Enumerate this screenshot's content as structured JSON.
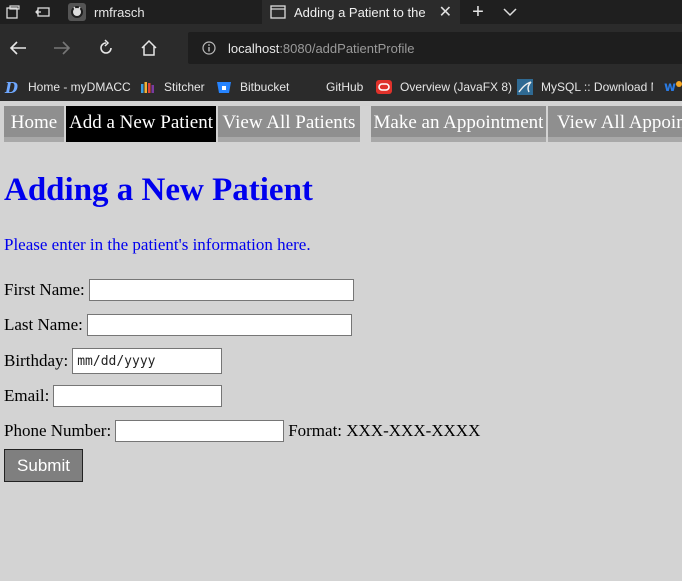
{
  "browser": {
    "tabs": [
      {
        "label": "rmfrasch",
        "icon": "github-icon"
      },
      {
        "label": "Adding a Patient to the",
        "icon": "page-icon"
      }
    ],
    "url_host": "localhost",
    "url_rest": ":8080/addPatientProfile",
    "favorites": [
      {
        "label": "Home - myDMACC",
        "icon": "dmacc-icon"
      },
      {
        "label": "Stitcher",
        "icon": "stitcher-icon"
      },
      {
        "label": "Bitbucket",
        "icon": "bitbucket-icon"
      },
      {
        "label": "GitHub",
        "icon": "none"
      },
      {
        "label": "Overview (JavaFX 8)",
        "icon": "oracle-icon"
      },
      {
        "label": "MySQL :: Download M",
        "icon": "mysql-icon"
      }
    ]
  },
  "nav": {
    "items": [
      {
        "label": "Home"
      },
      {
        "label": "Add a New Patient",
        "active": true
      },
      {
        "label": "View All Patients"
      },
      {
        "label": "Make an Appointment"
      },
      {
        "label": "View All Appoint"
      }
    ]
  },
  "page": {
    "title": "Adding a New Patient",
    "intro": "Please enter in the patient's information here."
  },
  "form": {
    "first_name_label": "First Name:",
    "last_name_label": "Last Name:",
    "birthday_label": "Birthday:",
    "birthday_placeholder": "mm/dd/yyyy",
    "email_label": "Email:",
    "phone_label": "Phone Number:",
    "phone_format": "Format: XXX-XXX-XXXX",
    "submit_label": "Submit"
  },
  "colors": {
    "heading": "#0000ee",
    "page_bg": "#d3d3d3",
    "nav_bg": "#8f8f8f",
    "nav_active_bg": "#000000"
  }
}
